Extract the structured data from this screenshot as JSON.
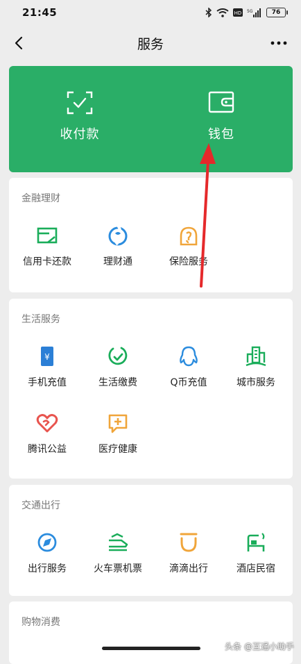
{
  "status_bar": {
    "time": "21:45",
    "battery": "76"
  },
  "header": {
    "title": "服务"
  },
  "top_card": {
    "items": [
      {
        "label": "收付款",
        "icon": "scan-pay-icon"
      },
      {
        "label": "钱包",
        "icon": "wallet-icon"
      }
    ],
    "background": "#2aae67"
  },
  "sections": [
    {
      "title": "金融理财",
      "items": [
        {
          "label": "信用卡还款",
          "icon": "credit-card-icon",
          "color": "#1aad5a"
        },
        {
          "label": "理财通",
          "icon": "licaitong-icon",
          "color": "#2b8cde"
        },
        {
          "label": "保险服务",
          "icon": "insurance-icon",
          "color": "#f0a53a"
        }
      ]
    },
    {
      "title": "生活服务",
      "items": [
        {
          "label": "手机充值",
          "icon": "mobile-topup-icon",
          "color": "#2b7fd6"
        },
        {
          "label": "生活缴费",
          "icon": "utility-bill-icon",
          "color": "#1aad5a"
        },
        {
          "label": "Q币充值",
          "icon": "qq-penguin-icon",
          "color": "#2b8cde"
        },
        {
          "label": "城市服务",
          "icon": "city-building-icon",
          "color": "#1aad5a"
        },
        {
          "label": "腾讯公益",
          "icon": "charity-heart-icon",
          "color": "#e8544e"
        },
        {
          "label": "医疗健康",
          "icon": "medical-icon",
          "color": "#f0a53a"
        }
      ]
    },
    {
      "title": "交通出行",
      "items": [
        {
          "label": "出行服务",
          "icon": "compass-icon",
          "color": "#2b8cde"
        },
        {
          "label": "火车票机票",
          "icon": "train-plane-icon",
          "color": "#1aad5a"
        },
        {
          "label": "滴滴出行",
          "icon": "didi-icon",
          "color": "#f0a53a"
        },
        {
          "label": "酒店民宿",
          "icon": "hotel-bed-icon",
          "color": "#1aad5a"
        }
      ]
    },
    {
      "title": "购物消费",
      "items": []
    }
  ],
  "watermark": "头条 @互通小助手",
  "annotation_color": "#e5292b"
}
